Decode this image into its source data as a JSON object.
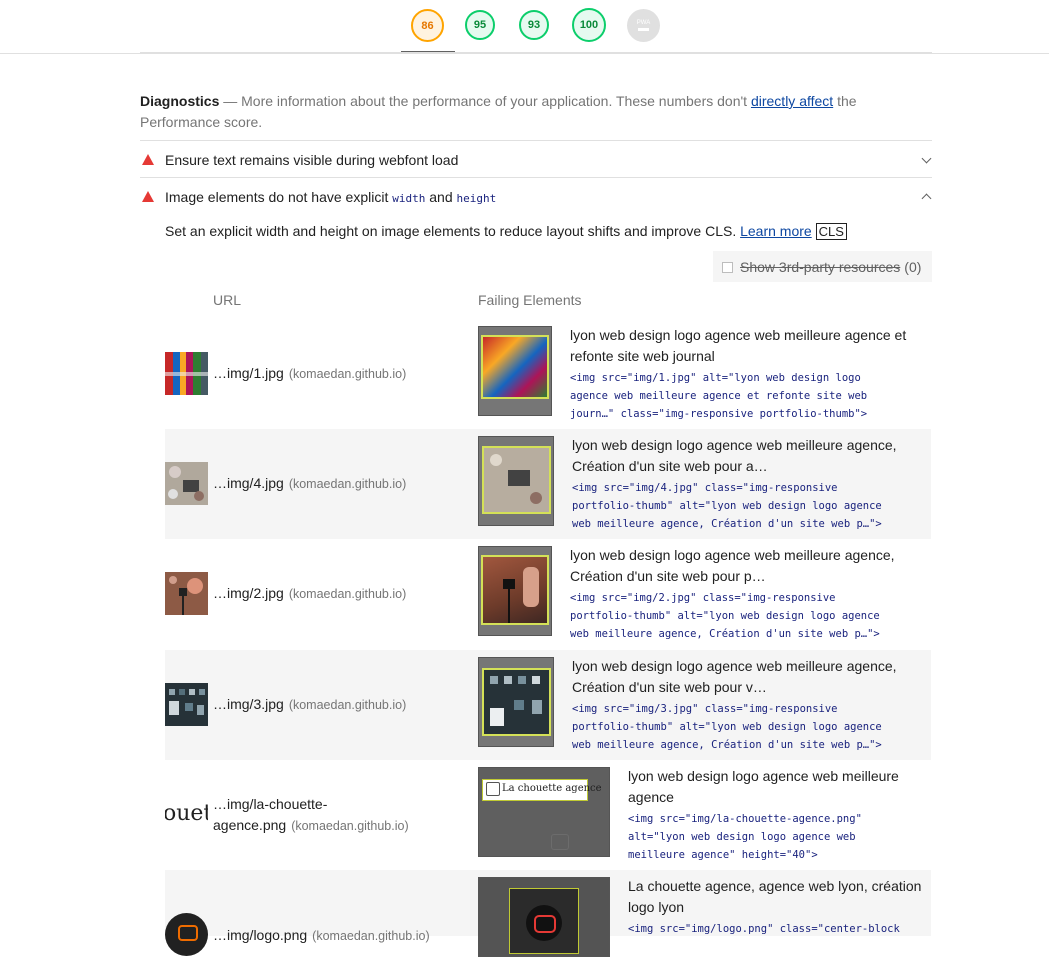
{
  "scores": [
    {
      "value": "86",
      "rating": "average"
    },
    {
      "value": "95",
      "rating": "pass"
    },
    {
      "value": "93",
      "rating": "pass"
    },
    {
      "value": "100",
      "rating": "pass"
    },
    {
      "value": "PWA",
      "rating": "pwa"
    }
  ],
  "diagnostics": {
    "heading": "Diagnostics",
    "text_before": " — More information about the performance of your application. These numbers don't ",
    "link": "directly affect",
    "text_after": " the Performance score."
  },
  "audits": [
    {
      "title": "Ensure text remains visible during webfont load",
      "expanded": false
    },
    {
      "title_parts": [
        "Image elements do not have explicit ",
        "width",
        " and ",
        "height"
      ],
      "expanded": true
    }
  ],
  "description": {
    "text": "Set an explicit width and height on image elements to reduce layout shifts and improve CLS. ",
    "link": "Learn more",
    "badge": "CLS"
  },
  "third_party": {
    "label": "Show 3rd-party resources",
    "count": "(0)"
  },
  "table": {
    "headers": [
      "URL",
      "Failing Elements"
    ],
    "rows": [
      {
        "url": "…img/1.jpg",
        "host": "(komaedan.github.io)",
        "node_label": "lyon web design logo agence web meilleure agence et refonte site web journal",
        "snippet": "<img src=\"img/1.jpg\" alt=\"lyon web design logo\nagence web meilleure agence et refonte site web\njourn…\" class=\"img-responsive portfolio-thumb\">"
      },
      {
        "url": "…img/4.jpg",
        "host": "(komaedan.github.io)",
        "node_label": "lyon web design logo agence web meilleure agence, Création d'un site web pour a…",
        "snippet": "<img src=\"img/4.jpg\" class=\"img-responsive\nportfolio-thumb\" alt=\"lyon web design logo agence\nweb meilleure agence, Création d'un site web p…\">"
      },
      {
        "url": "…img/2.jpg",
        "host": "(komaedan.github.io)",
        "node_label": "lyon web design logo agence web meilleure agence, Création d'un site web pour p…",
        "snippet": "<img src=\"img/2.jpg\" class=\"img-responsive\nportfolio-thumb\" alt=\"lyon web design logo agence\nweb meilleure agence, Création d'un site web p…\">"
      },
      {
        "url": "…img/3.jpg",
        "host": "(komaedan.github.io)",
        "node_label": "lyon web design logo agence web meilleure agence, Création d'un site web pour v…",
        "snippet": "<img src=\"img/3.jpg\" class=\"img-responsive\nportfolio-thumb\" alt=\"lyon web design logo agence\nweb meilleure agence, Création d'un site web p…\">"
      },
      {
        "url_line1": "…img/la-chouette-",
        "url_line2": "agence.png",
        "host": "(komaedan.github.io)",
        "thumb_text": "ouet",
        "shot_text": "La chouette agence",
        "node_label": "lyon web design logo agence web meilleure agence",
        "snippet": "<img src=\"img/la-chouette-agence.png\"\nalt=\"lyon web design logo agence web\nmeilleure agence\" height=\"40\">"
      },
      {
        "url": "…img/logo.png",
        "host": "(komaedan.github.io)",
        "node_label": "La chouette agence, agence web lyon, création logo lyon",
        "snippet": "<img src=\"img/logo.png\" class=\"center-block"
      }
    ]
  }
}
